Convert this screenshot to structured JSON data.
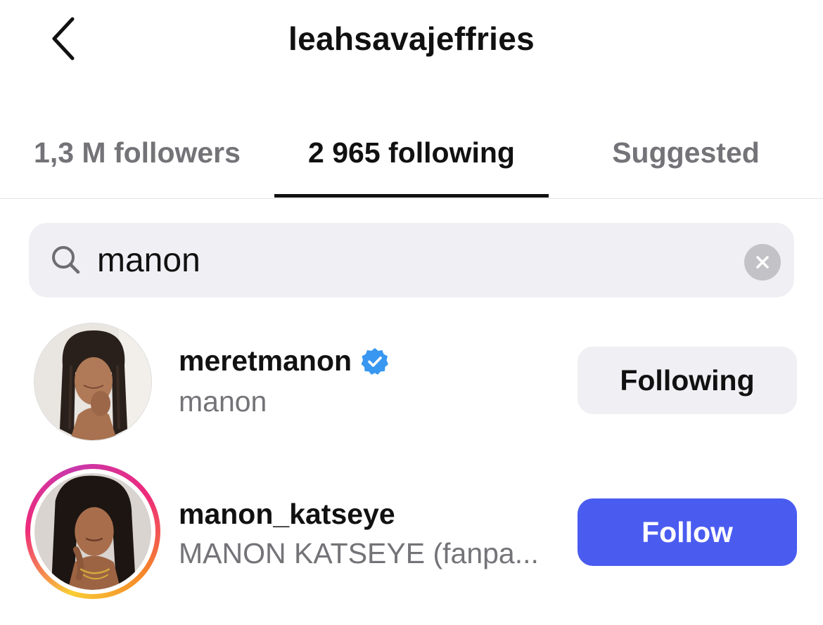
{
  "header": {
    "title": "leahsavajeffries",
    "back_icon": "chevron-left-icon"
  },
  "tabs": [
    {
      "label": "1,3 M followers",
      "active": false
    },
    {
      "label": "2 965 following",
      "active": true
    },
    {
      "label": "Suggested",
      "active": false
    }
  ],
  "search": {
    "value": "manon",
    "placeholder": "Search",
    "icon": "search-icon",
    "clear_icon": "clear-icon"
  },
  "results": [
    {
      "username": "meretmanon",
      "verified": true,
      "fullname": "manon",
      "button_label": "Following",
      "has_story_ring": false
    },
    {
      "username": "manon_katseye",
      "verified": false,
      "fullname": "MANON KATSEYE (fanpa...",
      "button_label": "Follow",
      "has_story_ring": true
    }
  ],
  "colors": {
    "accent": "#4a5cf0",
    "verified": "#3897f0",
    "muted_text": "#737378",
    "search_bg": "#efeff4"
  }
}
